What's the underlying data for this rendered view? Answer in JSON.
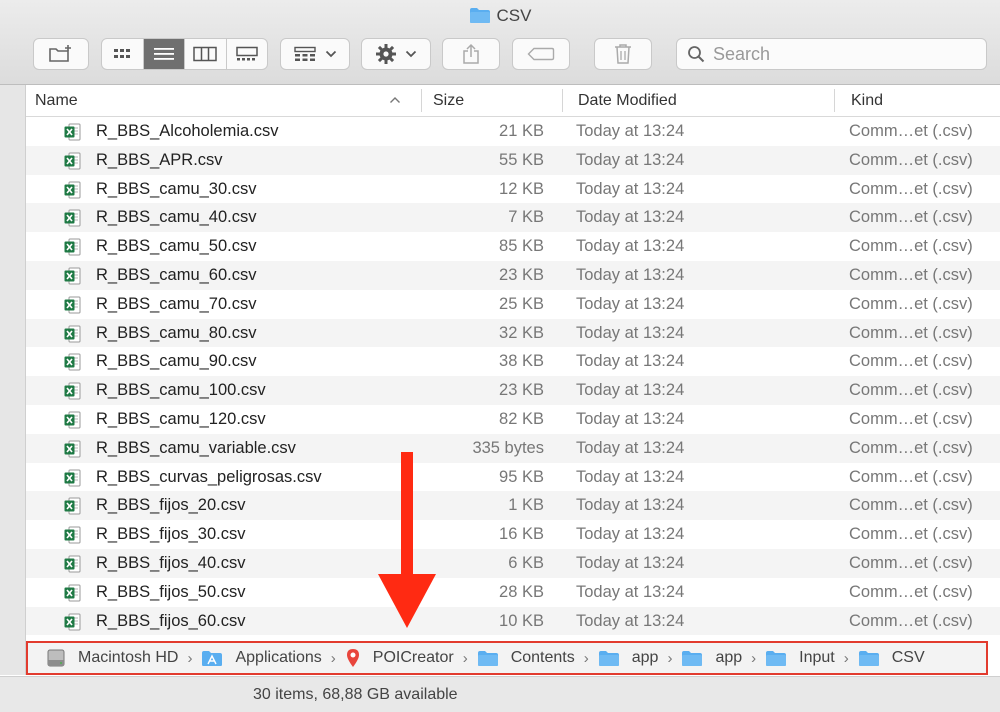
{
  "window": {
    "title": "CSV"
  },
  "toolbar": {
    "search_placeholder": "Search"
  },
  "columns": {
    "name": "Name",
    "size": "Size",
    "date": "Date Modified",
    "kind": "Kind"
  },
  "files": [
    {
      "name": "R_BBS_Alcoholemia.csv",
      "size": "21 KB",
      "date": "Today at 13:24",
      "kind": "Comm…et (.csv)"
    },
    {
      "name": "R_BBS_APR.csv",
      "size": "55 KB",
      "date": "Today at 13:24",
      "kind": "Comm…et (.csv)"
    },
    {
      "name": "R_BBS_camu_30.csv",
      "size": "12 KB",
      "date": "Today at 13:24",
      "kind": "Comm…et (.csv)"
    },
    {
      "name": "R_BBS_camu_40.csv",
      "size": "7 KB",
      "date": "Today at 13:24",
      "kind": "Comm…et (.csv)"
    },
    {
      "name": "R_BBS_camu_50.csv",
      "size": "85 KB",
      "date": "Today at 13:24",
      "kind": "Comm…et (.csv)"
    },
    {
      "name": "R_BBS_camu_60.csv",
      "size": "23 KB",
      "date": "Today at 13:24",
      "kind": "Comm…et (.csv)"
    },
    {
      "name": "R_BBS_camu_70.csv",
      "size": "25 KB",
      "date": "Today at 13:24",
      "kind": "Comm…et (.csv)"
    },
    {
      "name": "R_BBS_camu_80.csv",
      "size": "32 KB",
      "date": "Today at 13:24",
      "kind": "Comm…et (.csv)"
    },
    {
      "name": "R_BBS_camu_90.csv",
      "size": "38 KB",
      "date": "Today at 13:24",
      "kind": "Comm…et (.csv)"
    },
    {
      "name": "R_BBS_camu_100.csv",
      "size": "23 KB",
      "date": "Today at 13:24",
      "kind": "Comm…et (.csv)"
    },
    {
      "name": "R_BBS_camu_120.csv",
      "size": "82 KB",
      "date": "Today at 13:24",
      "kind": "Comm…et (.csv)"
    },
    {
      "name": "R_BBS_camu_variable.csv",
      "size": "335 bytes",
      "date": "Today at 13:24",
      "kind": "Comm…et (.csv)"
    },
    {
      "name": "R_BBS_curvas_peligrosas.csv",
      "size": "95 KB",
      "date": "Today at 13:24",
      "kind": "Comm…et (.csv)"
    },
    {
      "name": "R_BBS_fijos_20.csv",
      "size": "1 KB",
      "date": "Today at 13:24",
      "kind": "Comm…et (.csv)"
    },
    {
      "name": "R_BBS_fijos_30.csv",
      "size": "16 KB",
      "date": "Today at 13:24",
      "kind": "Comm…et (.csv)"
    },
    {
      "name": "R_BBS_fijos_40.csv",
      "size": "6 KB",
      "date": "Today at 13:24",
      "kind": "Comm…et (.csv)"
    },
    {
      "name": "R_BBS_fijos_50.csv",
      "size": "28 KB",
      "date": "Today at 13:24",
      "kind": "Comm…et (.csv)"
    },
    {
      "name": "R_BBS_fijos_60.csv",
      "size": "10 KB",
      "date": "Today at 13:24",
      "kind": "Comm…et (.csv)"
    }
  ],
  "path": [
    {
      "label": "Macintosh HD",
      "icon": "hard-drive-icon"
    },
    {
      "label": "Applications",
      "icon": "applications-folder-icon"
    },
    {
      "label": "POICreator",
      "icon": "map-pin-icon"
    },
    {
      "label": "Contents",
      "icon": "folder-icon"
    },
    {
      "label": "app",
      "icon": "folder-icon"
    },
    {
      "label": "app",
      "icon": "folder-icon"
    },
    {
      "label": "Input",
      "icon": "folder-icon"
    },
    {
      "label": "CSV",
      "icon": "folder-icon"
    }
  ],
  "status": {
    "text": "30 items, 68,88 GB available"
  },
  "colors": {
    "folder": "#5aaef0",
    "excel": "#1f7a45",
    "highlight": "#e23b2e",
    "view_active": "#6f6f6f"
  }
}
